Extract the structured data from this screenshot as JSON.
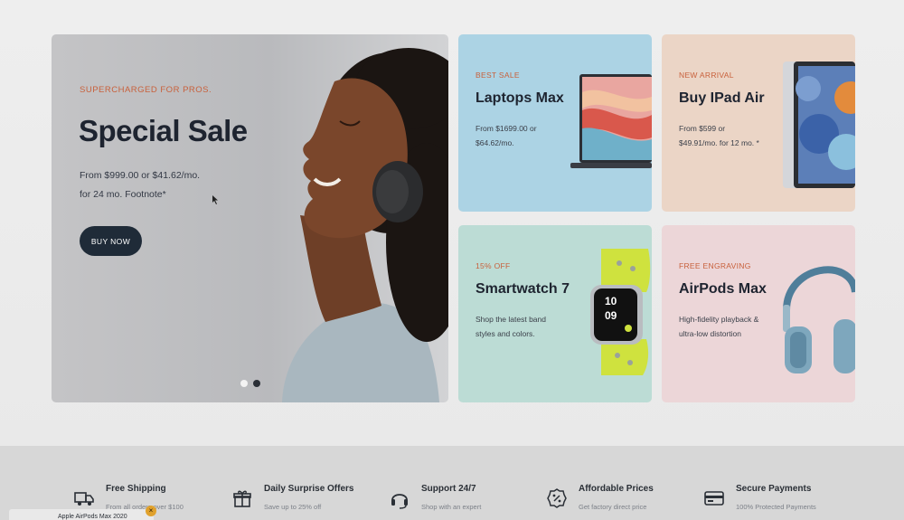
{
  "hero": {
    "eyebrow": "SUPERCHARGED FOR PROS.",
    "title": "Special Sale",
    "desc_line1": "From $999.00 or $41.62/mo.",
    "desc_line2": "for 24 mo. Footnote*",
    "button_label": "BUY NOW",
    "slides": [
      {
        "active": false
      },
      {
        "active": true
      }
    ]
  },
  "cards": [
    {
      "eyebrow": "BEST SALE",
      "title": "Laptops Max",
      "desc_line1": "From $1699.00 or",
      "desc_line2": "$64.62/mo."
    },
    {
      "eyebrow": "NEW ARRIVAL",
      "title": "Buy IPad Air",
      "desc_line1": "From $599 or",
      "desc_line2": "$49.91/mo. for 12 mo. *"
    },
    {
      "eyebrow": "15% OFF",
      "title": "Smartwatch 7",
      "desc_line1": "Shop the latest band",
      "desc_line2": "styles and colors."
    },
    {
      "eyebrow": "FREE ENGRAVING",
      "title": "AirPods Max",
      "desc_line1": "High-fidelity playback &",
      "desc_line2": "ultra-low distortion"
    }
  ],
  "features": [
    {
      "title": "Free Shipping",
      "subtitle": "From all orders over $100",
      "icon": "truck-icon"
    },
    {
      "title": "Daily Surprise Offers",
      "subtitle": "Save up to 25% off",
      "icon": "gift-icon"
    },
    {
      "title": "Support 24/7",
      "subtitle": "Shop with an expert",
      "icon": "headset-icon"
    },
    {
      "title": "Affordable Prices",
      "subtitle": "Get factory direct price",
      "icon": "percent-badge-icon"
    },
    {
      "title": "Secure Payments",
      "subtitle": "100% Protected Payments",
      "icon": "credit-card-icon"
    }
  ],
  "toast": {
    "text": "Apple AirPods Max 2020",
    "close": "×"
  },
  "colors": {
    "accent": "#c8603b",
    "dark": "#1f2b38"
  }
}
